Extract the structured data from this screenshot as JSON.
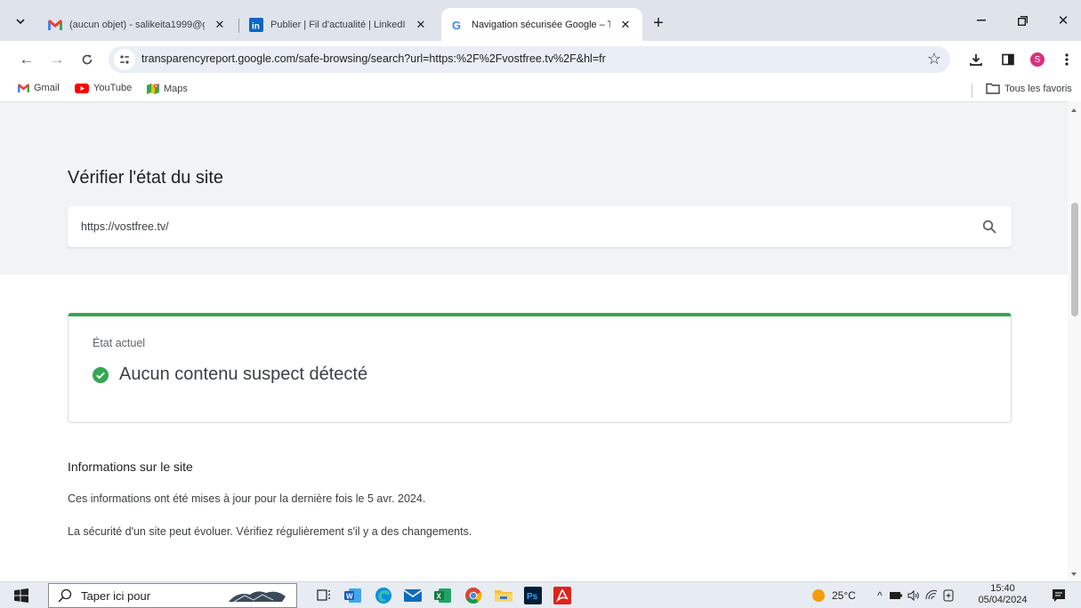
{
  "browser": {
    "tabs": [
      {
        "title": "(aucun objet) - salikeita1999@g",
        "icon": "gmail-icon",
        "active": false
      },
      {
        "title": "Publier | Fil d'actualité | LinkedI",
        "icon": "linkedin-icon",
        "active": false
      },
      {
        "title": "Navigation sécurisée Google – T",
        "icon": "google-icon",
        "active": true
      }
    ],
    "address": "transparencyreport.google.com/safe-browsing/search?url=https:%2F%2Fvostfree.tv%2F&hl=fr",
    "profile_initial": "S",
    "bookmarks": [
      {
        "label": "Gmail",
        "icon": "gmail-icon"
      },
      {
        "label": "YouTube",
        "icon": "youtube-icon"
      },
      {
        "label": "Maps",
        "icon": "maps-icon"
      }
    ],
    "all_bookmarks_label": "Tous les favoris"
  },
  "page": {
    "title": "Vérifier l'état du site",
    "search_value": "https://vostfree.tv/",
    "status": {
      "label": "État actuel",
      "result": "Aucun contenu suspect détecté",
      "color": "#34a853"
    },
    "info": {
      "title": "Informations sur le site",
      "line1": "Ces informations ont été mises à jour pour la dernière fois le 5 avr. 2024.",
      "line2": "La sécurité d'un site peut évoluer. Vérifiez régulièrement s'il y a des changements."
    }
  },
  "taskbar": {
    "search_placeholder": "Taper ici pour",
    "temperature": "25°C",
    "time": "15:40",
    "date": "05/04/2024",
    "apps": [
      "task-view-icon",
      "word-icon",
      "edge-icon",
      "mail-icon",
      "excel-icon",
      "chrome-icon",
      "file-explorer-icon",
      "photoshop-icon",
      "acrobat-icon"
    ]
  }
}
